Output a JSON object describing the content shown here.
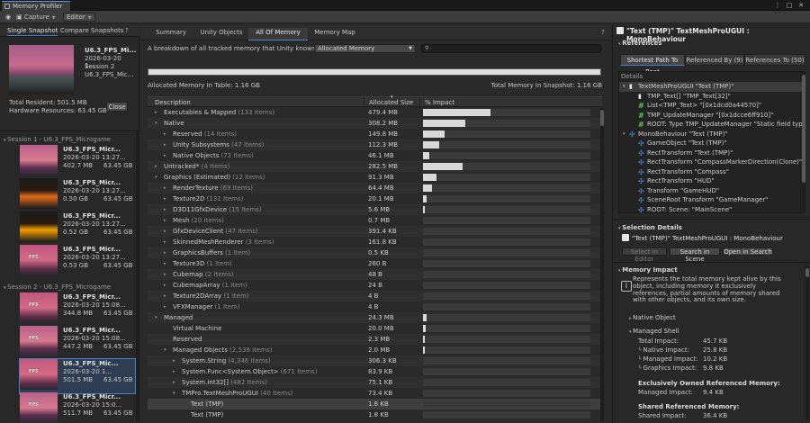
{
  "window": {
    "title": "Memory Profiler"
  },
  "toolbar": {
    "capture_label": "Capture",
    "editor_label": "Editor"
  },
  "left": {
    "tabs": [
      "Single Snapshot",
      "Compare Snapshots"
    ],
    "selected": {
      "name": "U6.3_FPS_Mi...",
      "date": "2026-03-20 1...",
      "session": "Session 2",
      "name2": "U6.3_FPS_Mic...",
      "total_resident": "Total Resident: 501.5 MB",
      "hardware": "Hardware Resources: 63.45 GB",
      "close_label": "Close"
    },
    "sessions": [
      {
        "title": "Session 1 - U6.3_FPS_Microgame",
        "snapshots": [
          {
            "name": "U6.3_FPS_Micr...",
            "date": "2026-03-20 13:27...",
            "size": "402.7 MB",
            "hw": "63.45 GB"
          },
          {
            "name": "U6.3_FPS_Micr...",
            "date": "2026-03-20 13:27...",
            "size": "0.50 GB",
            "hw": "63.45 GB"
          },
          {
            "name": "U6.3_FPS_Micr...",
            "date": "2026-03-20 13:27...",
            "size": "0.52 GB",
            "hw": "63.45 GB"
          },
          {
            "name": "U6.3_FPS_Micr...",
            "date": "2026-03-20 13:27...",
            "size": "0.53 GB",
            "hw": "63.45 GB"
          }
        ]
      },
      {
        "title": "Session 2 - U6.3_FPS_Microgame",
        "snapshots": [
          {
            "name": "U6.3_FPS_Micr...",
            "date": "2026-03-20 15:08...",
            "size": "344.8 MB",
            "hw": "63.45 GB"
          },
          {
            "name": "U6.3_FPS_Micr...",
            "date": "2026-03-20 15:08...",
            "size": "447.2 MB",
            "hw": "63.45 GB"
          },
          {
            "name": "U6.3_FPS_Mic...",
            "date": "2026-03-20 1...",
            "size": "501.5 MB",
            "hw": "63.45 GB"
          },
          {
            "name": "U6.3_FPS_Micr...",
            "date": "2026-03-20 15:0...",
            "size": "511.7 MB",
            "hw": "63.45 GB"
          }
        ]
      }
    ]
  },
  "center": {
    "tabs": [
      "Summary",
      "Unity Objects",
      "All Of Memory",
      "Memory Map"
    ],
    "description": "A breakdown of all tracked memory that Unity knows about.",
    "filter_value": "Allocated Memory",
    "allocated_in_table": "Allocated Memory In Table: 1.16 GB",
    "total_in_snapshot": "Total Memory In Snapshot: 1.16 GB",
    "columns": {
      "description": "Description",
      "size": "Allocated Size",
      "impact": "% Impact"
    },
    "rows": [
      {
        "name": "Executables & Mapped",
        "count": "(133 Items)",
        "size": "479.4 MB",
        "impact": 0.41,
        "indent": 1,
        "arrow": "▸"
      },
      {
        "name": "Native",
        "count": "",
        "size": "308.2 MB",
        "impact": 0.26,
        "indent": 1,
        "arrow": "▾"
      },
      {
        "name": "Reserved",
        "count": "(14 Items)",
        "size": "149.8 MB",
        "impact": 0.13,
        "indent": 2,
        "arrow": "▸"
      },
      {
        "name": "Unity Subsystems",
        "count": "(47 Items)",
        "size": "112.3 MB",
        "impact": 0.1,
        "indent": 2,
        "arrow": "▸"
      },
      {
        "name": "Native Objects",
        "count": "(72 Items)",
        "size": "46.1 MB",
        "impact": 0.04,
        "indent": 2,
        "arrow": "▸"
      },
      {
        "name": "Untracked*",
        "count": "(4 Items)",
        "size": "282.5 MB",
        "impact": 0.24,
        "indent": 1,
        "arrow": "▸"
      },
      {
        "name": "Graphics (Estimated)",
        "count": "(12 Items)",
        "size": "91.3 MB",
        "impact": 0.08,
        "indent": 1,
        "arrow": "▾"
      },
      {
        "name": "RenderTexture",
        "count": "(69 Items)",
        "size": "64.4 MB",
        "impact": 0.055,
        "indent": 2,
        "arrow": "▸"
      },
      {
        "name": "Texture2D",
        "count": "(131 Items)",
        "size": "20.1 MB",
        "impact": 0.02,
        "indent": 2,
        "arrow": "▸"
      },
      {
        "name": "D3D11GfxDevice",
        "count": "(15 Items)",
        "size": "5.6 MB",
        "impact": 0.006,
        "indent": 2,
        "arrow": "▸"
      },
      {
        "name": "Mesh",
        "count": "(20 Items)",
        "size": "0.7 MB",
        "impact": 0,
        "indent": 2,
        "arrow": "▸"
      },
      {
        "name": "GfxDeviceClient",
        "count": "(47 Items)",
        "size": "391.4 KB",
        "impact": 0,
        "indent": 2,
        "arrow": "▸"
      },
      {
        "name": "SkinnedMeshRenderer",
        "count": "(3 Items)",
        "size": "161.8 KB",
        "impact": 0,
        "indent": 2,
        "arrow": "▸"
      },
      {
        "name": "GraphicsBuffers",
        "count": "(1 Item)",
        "size": "0.5 KB",
        "impact": 0,
        "indent": 2,
        "arrow": "▸"
      },
      {
        "name": "Texture3D",
        "count": "(1 Item)",
        "size": "260 B",
        "impact": 0,
        "indent": 2,
        "arrow": "▸"
      },
      {
        "name": "Cubemap",
        "count": "(2 Items)",
        "size": "48 B",
        "impact": 0,
        "indent": 2,
        "arrow": "▸"
      },
      {
        "name": "CubemapArray",
        "count": "(1 Item)",
        "size": "24 B",
        "impact": 0,
        "indent": 2,
        "arrow": "▸"
      },
      {
        "name": "Texture2DArray",
        "count": "(1 Item)",
        "size": "4 B",
        "impact": 0,
        "indent": 2,
        "arrow": "▸"
      },
      {
        "name": "VFXManager",
        "count": "(1 Item)",
        "size": "4 B",
        "impact": 0,
        "indent": 2,
        "arrow": "▸"
      },
      {
        "name": "Managed",
        "count": "",
        "size": "24.3 MB",
        "impact": 0.02,
        "indent": 1,
        "arrow": "▾"
      },
      {
        "name": "Virtual Machine",
        "count": "",
        "size": "20.0 MB",
        "impact": 0.017,
        "indent": 2,
        "arrow": ""
      },
      {
        "name": "Reserved",
        "count": "",
        "size": "2.3 MB",
        "impact": 0.002,
        "indent": 2,
        "arrow": ""
      },
      {
        "name": "Managed Objects",
        "count": "(2,538 Items)",
        "size": "2.0 MB",
        "impact": 0.002,
        "indent": 2,
        "arrow": "▾"
      },
      {
        "name": "System.String",
        "count": "(4,346 Items)",
        "size": "306.3 KB",
        "impact": 0,
        "indent": 3,
        "arrow": "▸"
      },
      {
        "name": "System.Func<System.Object>",
        "count": "(671 Items)",
        "size": "83.9 KB",
        "impact": 0,
        "indent": 3,
        "arrow": "▸"
      },
      {
        "name": "System.Int32[]",
        "count": "(482 Items)",
        "size": "75.1 KB",
        "impact": 0,
        "indent": 3,
        "arrow": "▸"
      },
      {
        "name": "TMPro.TextMeshProUGUI",
        "count": "(40 Items)",
        "size": "73.4 KB",
        "impact": 0,
        "indent": 3,
        "arrow": "▾"
      },
      {
        "name": "Text (TMP)",
        "count": "",
        "size": "1.8 KB",
        "impact": 0,
        "indent": 4,
        "arrow": ""
      },
      {
        "name": "Text (TMP)",
        "count": "",
        "size": "1.8 KB",
        "impact": 0,
        "indent": 4,
        "arrow": ""
      }
    ]
  },
  "right": {
    "title": "\"Text (TMP)\" TextMeshProUGUI : MonoBehaviour",
    "references_label": "References",
    "ref_tabs": [
      "Shortest Path To Root",
      "Referenced By (9)",
      "References To (50)"
    ],
    "details_label": "Details",
    "details": [
      {
        "text": "TextMeshProUGUI \"Text (TMP)\"",
        "indent": 0,
        "icon": "doc",
        "arrow": "▾",
        "hl": true
      },
      {
        "text": "TMP_Text[] \"TMP_Text[32]\"",
        "indent": 1,
        "icon": "doc",
        "arrow": ""
      },
      {
        "text": "List<TMP_Text> \"[0x1dcd0a44570]\"",
        "indent": 1,
        "icon": "hash",
        "arrow": ""
      },
      {
        "text": "TMP_UpdateManager \"[0x1dcce6ff910]\"",
        "indent": 1,
        "icon": "hash",
        "arrow": ""
      },
      {
        "text": "ROOT: Type TMP_UpdateManager \"Static field type re",
        "indent": 1,
        "icon": "hash",
        "arrow": ""
      },
      {
        "text": "MonoBehaviour \"Text (TMP)\"",
        "indent": 0,
        "icon": "link",
        "arrow": "▾"
      },
      {
        "text": "GameObject \"Text (TMP)\"",
        "indent": 1,
        "icon": "link",
        "arrow": ""
      },
      {
        "text": "RectTransform \"Text (TMP)\"",
        "indent": 1,
        "icon": "link",
        "arrow": ""
      },
      {
        "text": "RectTransform \"CompassMarkerDirection(Clone)\"",
        "indent": 1,
        "icon": "link",
        "arrow": ""
      },
      {
        "text": "RectTransform \"Compass\"",
        "indent": 1,
        "icon": "link",
        "arrow": ""
      },
      {
        "text": "RectTransform \"HUD\"",
        "indent": 1,
        "icon": "link",
        "arrow": ""
      },
      {
        "text": "Transform \"GameHUD\"",
        "indent": 1,
        "icon": "link",
        "arrow": ""
      },
      {
        "text": "SceneRoot Transform \"GameManager\"",
        "indent": 1,
        "icon": "link",
        "arrow": ""
      },
      {
        "text": "ROOT: Scene: \"MainScene\"",
        "indent": 1,
        "icon": "link",
        "arrow": ""
      }
    ],
    "selection_details_label": "Selection Details",
    "selection_title": "\"Text (TMP)\" TextMeshProUGUI : MonoBehaviour",
    "select_in_editor": "Select in Editor",
    "search_in_scene": "Search in Scene",
    "open_in_search": "Open in Search",
    "memory_impact_label": "Memory Impact",
    "impact_text": "Represents the total memory kept alive by this object, including memory it exclusively references, partial amounts of memory shared with other objects, and its own size.",
    "native_object_label": "Native Object",
    "managed_shell_label": "Managed Shell",
    "total_impact_label": "Total Impact:",
    "total_impact": "45.7 KB",
    "native_impact_label": "Native Impact:",
    "native_impact": "25.8 KB",
    "managed_impact_label": "Managed Impact:",
    "managed_impact": "10.2 KB",
    "graphics_impact_label": "Graphics Impact:",
    "graphics_impact": "9.8 KB",
    "exclusive_label": "Exclusively Owned Referenced Memory:",
    "exclusive_managed_label": "Managed Impact:",
    "exclusive_managed": "9.4 KB",
    "shared_label": "Shared Referenced Memory:",
    "shared_impact_label": "Shared Impact:",
    "shared_impact": "36.4 KB"
  }
}
